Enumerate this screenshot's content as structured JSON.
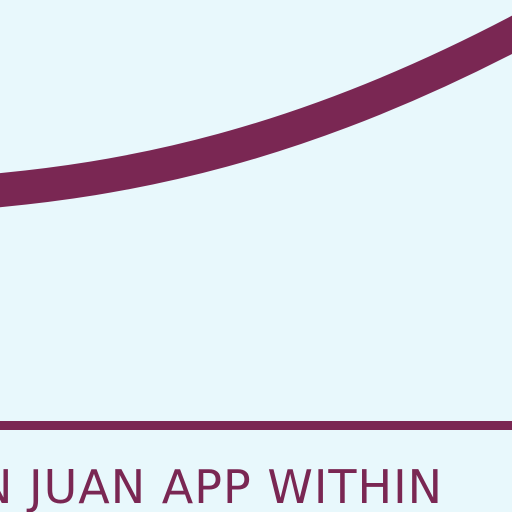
{
  "caption": {
    "text": "N JUAN APP WITHIN"
  },
  "colors": {
    "background": "#e8f8fc",
    "accent": "#7a2753"
  }
}
